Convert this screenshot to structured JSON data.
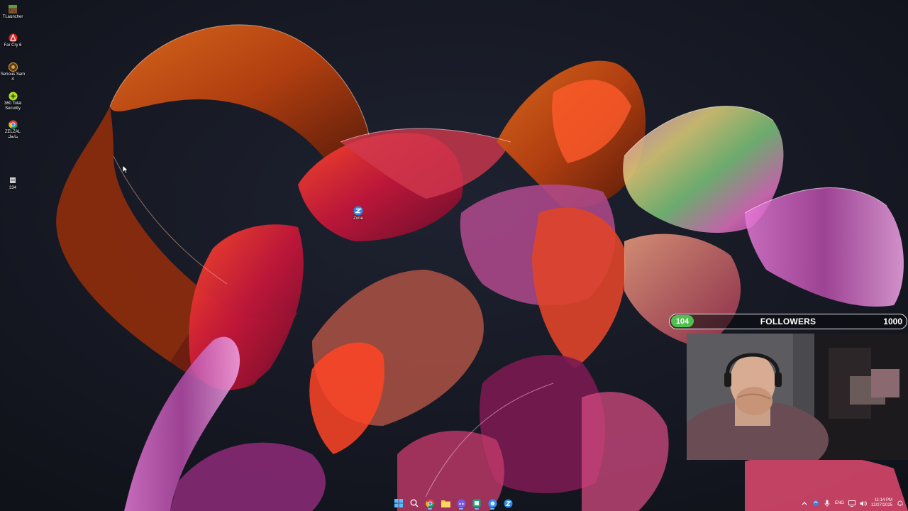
{
  "desktop_icons": [
    {
      "label": "TLauncher",
      "icon": "minecraft-grass-icon"
    },
    {
      "label": "Far Cry 6",
      "icon": "far-cry-icon"
    },
    {
      "label": "Serious Sam 4",
      "icon": "serious-sam-icon"
    },
    {
      "label": "360 Total Security",
      "icon": "shield-plus-icon"
    },
    {
      "label": "ZELZAL يتابعك",
      "icon": "chrome-icon"
    },
    {
      "label": "334",
      "icon": "file-icon"
    },
    {
      "label": "Zone",
      "icon": "zone-icon"
    }
  ],
  "followers_widget": {
    "current": "104",
    "title": "FOLLOWERS",
    "goal": "1000",
    "progress_fraction": 0.104,
    "accent_color": "#4fbf4f"
  },
  "taskbar": {
    "apps": [
      "windows-start-icon",
      "search-icon",
      "chrome-icon",
      "file-explorer-icon",
      "discord-icon",
      "store-icon",
      "browser-icon",
      "zone-icon"
    ],
    "tray": {
      "language": "ENG",
      "time": "11:14 PM",
      "date": "12/27/2025"
    }
  }
}
